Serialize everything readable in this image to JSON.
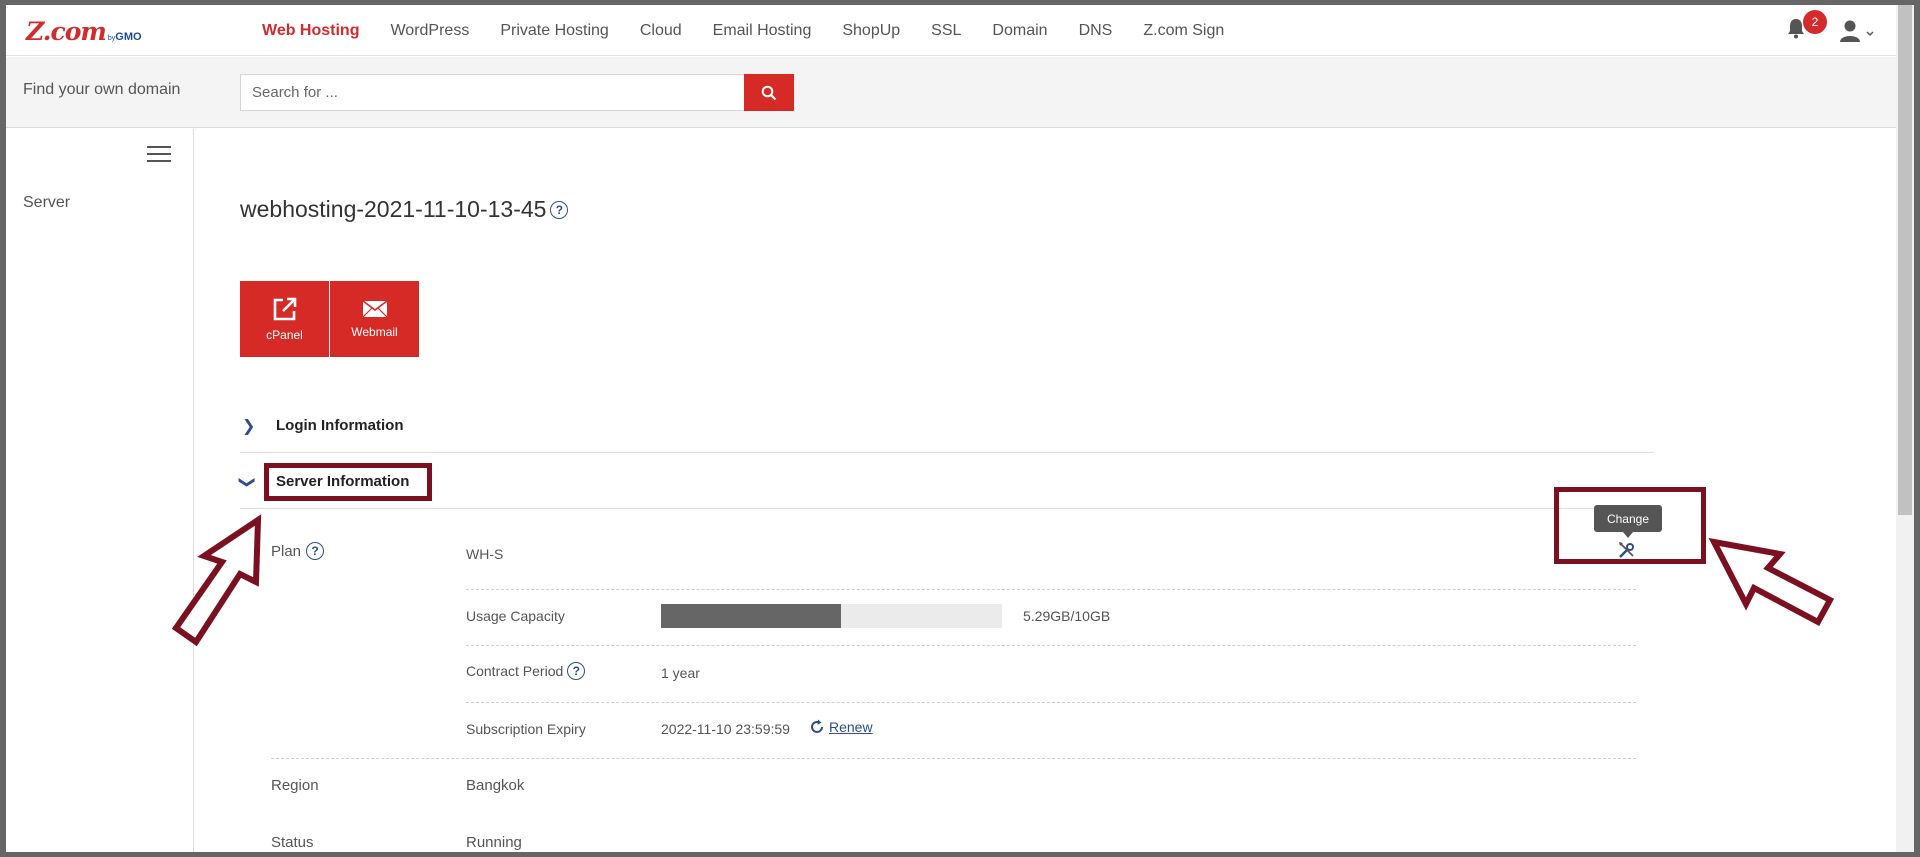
{
  "header": {
    "logo_main": "Z.com",
    "logo_by": "by",
    "logo_brand": "GMO",
    "nav": [
      {
        "label": "Web Hosting",
        "active": true
      },
      {
        "label": "WordPress"
      },
      {
        "label": "Private Hosting"
      },
      {
        "label": "Cloud"
      },
      {
        "label": "Email Hosting"
      },
      {
        "label": "ShopUp"
      },
      {
        "label": "SSL"
      },
      {
        "label": "Domain"
      },
      {
        "label": "DNS"
      },
      {
        "label": "Z.com Sign"
      }
    ],
    "notification_count": "2",
    "icons": [
      "bell-icon",
      "user-icon",
      "chevron-down-icon"
    ]
  },
  "search": {
    "label": "Find your own domain",
    "placeholder": "Search for ..."
  },
  "sidebar": {
    "items": [
      {
        "label": "Server"
      }
    ]
  },
  "main": {
    "title": "webhosting-2021-11-10-13-45",
    "tiles": [
      {
        "label": "cPanel",
        "icon": "external-link-icon"
      },
      {
        "label": "Webmail",
        "icon": "envelope-icon"
      }
    ],
    "sections": [
      {
        "label": "Login Information",
        "expanded": false
      },
      {
        "label": "Server Information",
        "expanded": true
      }
    ],
    "server_info": {
      "plan_label": "Plan",
      "plan_name": "WH-S",
      "usage_label": "Usage Capacity",
      "usage_text": "5.29GB/10GB",
      "usage_fraction": 0.529,
      "contract_label": "Contract Period",
      "contract_value": "1 year",
      "expiry_label": "Subscription Expiry",
      "expiry_value": "2022-11-10 23:59:59",
      "renew_label": "Renew",
      "region_label": "Region",
      "region_value": "Bangkok",
      "status_label": "Status",
      "status_value": "Running",
      "change_tooltip": "Change"
    }
  },
  "colors": {
    "brand_red": "#d62a26",
    "annotation": "#7a1020",
    "link_blue": "#2c4f8c"
  }
}
